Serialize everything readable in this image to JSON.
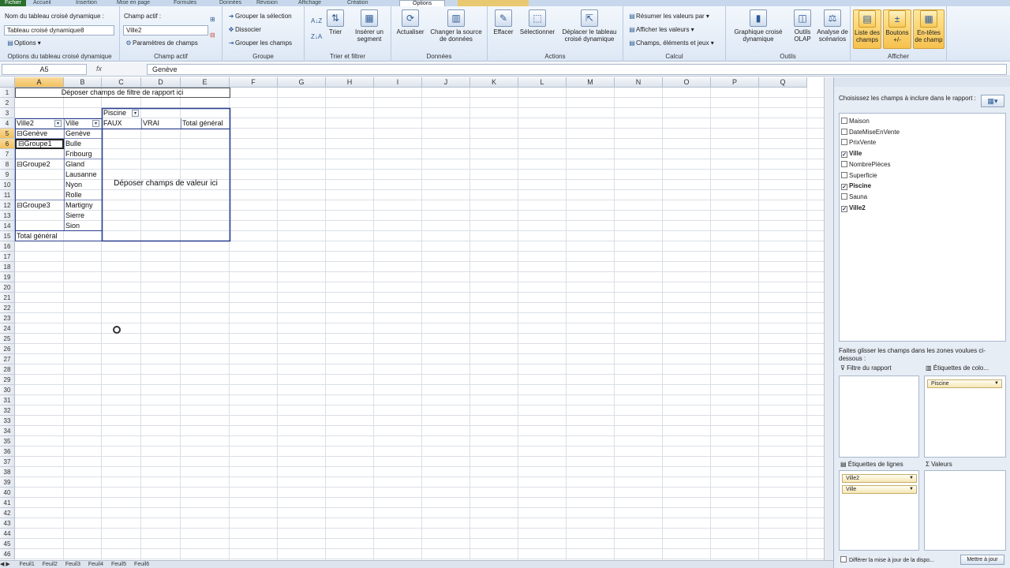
{
  "tabs": [
    "Fichier",
    "Accueil",
    "Insertion",
    "Mise en page",
    "Formules",
    "Données",
    "Révision",
    "Affichage",
    "Création",
    "Options"
  ],
  "active_tab": "Options",
  "ribbon": {
    "pivot_name_label": "Nom du tableau croisé dynamique :",
    "pivot_name_value": "Tableau croisé dynamique8",
    "options_label": "Options",
    "group_options": "Options du tableau croisé dynamique",
    "active_field_label": "Champ actif :",
    "active_field_value": "Ville2",
    "field_settings": "Paramètres de champs",
    "group_active_field": "Champ actif",
    "group_selection": "Grouper la sélection",
    "ungroup": "Dissocier",
    "group_field": "Grouper les champs",
    "group_group": "Groupe",
    "sort": "Trier",
    "insert_segment": "Insérer un segment",
    "group_sort": "Trier et filtrer",
    "refresh": "Actualiser",
    "change_source": "Changer la source de données",
    "group_data": "Données",
    "clear": "Effacer",
    "select": "Sélectionner",
    "move": "Déplacer le tableau croisé dynamique",
    "group_actions": "Actions",
    "summarize": "Résumer les valeurs par",
    "show_values": "Afficher les valeurs",
    "fields_items": "Champs, éléments et jeux",
    "group_calc": "Calcul",
    "pivot_chart": "Graphique croisé dynamique",
    "olap": "Outils OLAP",
    "scenario": "Analyse de scénarios",
    "group_tools": "Outils",
    "field_list": "Liste des champs",
    "buttons": "Boutons +/-",
    "headers": "En-têtes de champ",
    "group_show": "Afficher"
  },
  "formula": {
    "namebox": "A5",
    "fx": "fx",
    "value": "Genève"
  },
  "columns": [
    "A",
    "B",
    "C",
    "D",
    "E",
    "F",
    "G",
    "H",
    "I",
    "J",
    "K",
    "L",
    "M",
    "N",
    "O",
    "P",
    "Q"
  ],
  "rows": [
    "1",
    "2",
    "3",
    "4",
    "5",
    "6",
    "7",
    "8",
    "9",
    "10",
    "11",
    "12",
    "13",
    "14",
    "15",
    "16",
    "17",
    "18",
    "19",
    "20",
    "21",
    "22",
    "23",
    "24",
    "25",
    "26",
    "27",
    "28",
    "29",
    "30",
    "31",
    "32",
    "33",
    "34",
    "35",
    "36",
    "37",
    "38",
    "39",
    "40",
    "41",
    "42",
    "43",
    "44",
    "45",
    "46"
  ],
  "pivot": {
    "filter_drop": "Déposer champs de filtre de rapport ici",
    "col_field": "Piscine",
    "row_field_1": "Ville2",
    "row_field_2": "Ville",
    "col_faux": "FAUX",
    "col_vrai": "VRAI",
    "col_total": "Total général",
    "value_drop": "Déposer champs de valeur ici",
    "grand_total": "Total général",
    "groups": [
      {
        "label": "Genève",
        "cities": [
          "Genève"
        ]
      },
      {
        "label": "Groupe1",
        "cities": [
          "Bulle",
          "Fribourg"
        ]
      },
      {
        "label": "Groupe2",
        "cities": [
          "Gland",
          "Lausanne",
          "Nyon",
          "Rolle"
        ]
      },
      {
        "label": "Groupe3",
        "cities": [
          "Martigny",
          "Sierre",
          "Sion"
        ]
      }
    ]
  },
  "sheet_tabs": [
    "Feuil1",
    "Feuil2",
    "Feuil3",
    "Feuil4",
    "Feuil5",
    "Feuil6"
  ],
  "panel": {
    "title": "Choisissez les champs à inclure dans le rapport :",
    "fields": [
      {
        "name": "Maison",
        "checked": false
      },
      {
        "name": "DateMiseEnVente",
        "checked": false
      },
      {
        "name": "PrixVente",
        "checked": false
      },
      {
        "name": "Ville",
        "checked": true
      },
      {
        "name": "NombrePièces",
        "checked": false
      },
      {
        "name": "Superficie",
        "checked": false
      },
      {
        "name": "Piscine",
        "checked": true
      },
      {
        "name": "Sauna",
        "checked": false
      },
      {
        "name": "Ville2",
        "checked": true
      }
    ],
    "drag_text": "Faites glisser les champs dans les zones voulues ci-dessous :",
    "area_filter": "Filtre du rapport",
    "area_columns": "Étiquettes de colo...",
    "area_rows": "Étiquettes de lignes",
    "area_values": "Valeurs",
    "col_pills": [
      "Piscine"
    ],
    "row_pills": [
      "Ville2",
      "Ville"
    ],
    "defer": "Différer la mise à jour de la dispo...",
    "update": "Mettre à jour"
  }
}
